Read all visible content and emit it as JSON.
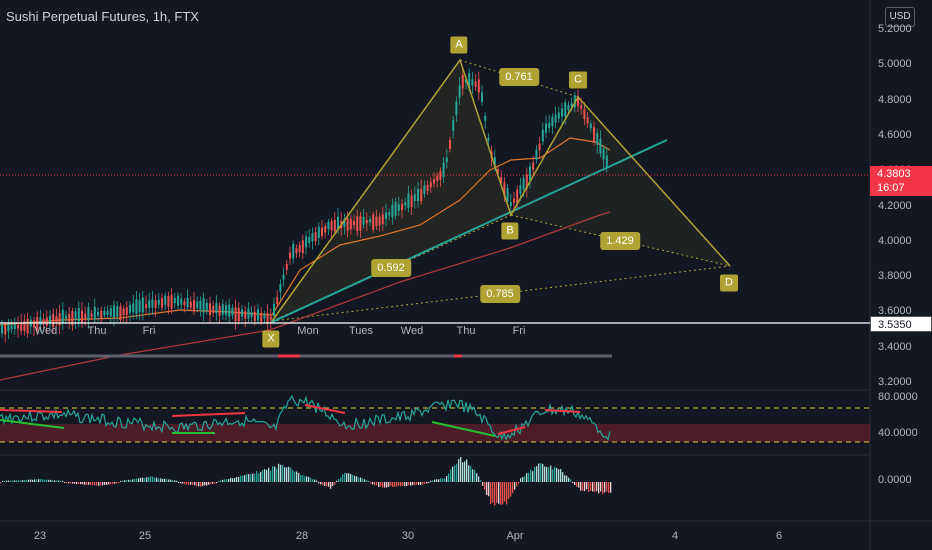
{
  "header": {
    "title": "Sushi Perpetual Futures, 1h, FTX",
    "currency_button": "USD"
  },
  "price_axis": {
    "ticks": [
      "5.2000",
      "5.0000",
      "4.8000",
      "4.6000",
      "4.4000",
      "4.2000",
      "4.0000",
      "3.8000",
      "3.6000",
      "3.4000",
      "3.2000"
    ],
    "current_price": "4.3803",
    "countdown": "16:07",
    "horizontal_line_price": "3.5350"
  },
  "rsi_axis": {
    "ticks": [
      "80.0000",
      "40.0000"
    ]
  },
  "macd_axis": {
    "ticks": [
      "0.0000"
    ]
  },
  "in_chart_days": [
    "Wed",
    "Thu",
    "Fri",
    "Mon",
    "Tues",
    "Wed",
    "Thu",
    "Fri"
  ],
  "time_axis": [
    "23",
    "25",
    "28",
    "30",
    "Apr",
    "4",
    "6"
  ],
  "pattern": {
    "points": [
      "X",
      "A",
      "B",
      "C",
      "D"
    ],
    "ratios": [
      "0.761",
      "0.592",
      "1.429",
      "0.785"
    ],
    "colors": {
      "pattern": "#b0a233",
      "trendline": "#26a69a",
      "up": "#26a69a",
      "down": "#ef5350",
      "ma": "#e0762b",
      "ma2": "#b23a3a"
    }
  }
}
